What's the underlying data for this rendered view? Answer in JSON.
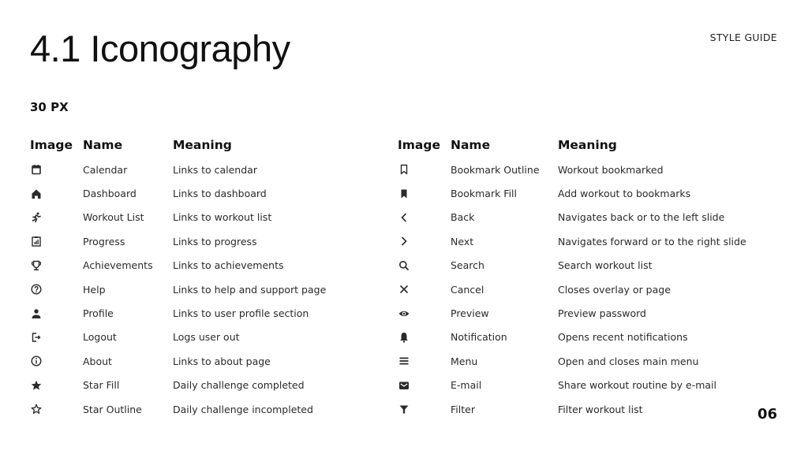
{
  "header": {
    "title": "4.1 Iconography",
    "section_label": "STYLE GUIDE",
    "size_label": "30 PX",
    "page_number": "06"
  },
  "colors": {
    "icon": "#2b2b2b",
    "text": "#1f1f1f",
    "background": "#ffffff"
  },
  "columns": {
    "image": "Image",
    "name": "Name",
    "meaning": "Meaning"
  },
  "left_table": [
    {
      "icon": "calendar-icon",
      "name": "Calendar",
      "meaning": "Links to calendar"
    },
    {
      "icon": "home-icon",
      "name": "Dashboard",
      "meaning": "Links to dashboard"
    },
    {
      "icon": "running-icon",
      "name": "Workout List",
      "meaning": "Links to workout list"
    },
    {
      "icon": "clipboard-chart-icon",
      "name": "Progress",
      "meaning": "Links to progress"
    },
    {
      "icon": "trophy-icon",
      "name": "Achievements",
      "meaning": "Links to achievements"
    },
    {
      "icon": "help-circle-icon",
      "name": "Help",
      "meaning": "Links to help and support page"
    },
    {
      "icon": "person-icon",
      "name": "Profile",
      "meaning": "Links to user profile section"
    },
    {
      "icon": "logout-icon",
      "name": "Logout",
      "meaning": "Logs user out"
    },
    {
      "icon": "info-circle-icon",
      "name": "About",
      "meaning": "Links to about page"
    },
    {
      "icon": "star-fill-icon",
      "name": "Star Fill",
      "meaning": "Daily challenge completed"
    },
    {
      "icon": "star-outline-icon",
      "name": "Star Outline",
      "meaning": "Daily challenge incompleted"
    }
  ],
  "right_table": [
    {
      "icon": "bookmark-outline-icon",
      "name": "Bookmark Outline",
      "meaning": "Workout bookmarked"
    },
    {
      "icon": "bookmark-fill-icon",
      "name": "Bookmark Fill",
      "meaning": "Add workout to bookmarks"
    },
    {
      "icon": "chevron-left-icon",
      "name": "Back",
      "meaning": "Navigates back or to the left slide"
    },
    {
      "icon": "chevron-right-icon",
      "name": "Next",
      "meaning": "Navigates forward or to the right slide"
    },
    {
      "icon": "search-icon",
      "name": "Search",
      "meaning": "Search workout list"
    },
    {
      "icon": "close-icon",
      "name": "Cancel",
      "meaning": "Closes overlay or page"
    },
    {
      "icon": "eye-icon",
      "name": "Preview",
      "meaning": "Preview password"
    },
    {
      "icon": "bell-icon",
      "name": "Notification",
      "meaning": "Opens recent notifications"
    },
    {
      "icon": "menu-icon",
      "name": "Menu",
      "meaning": "Open and closes main menu"
    },
    {
      "icon": "mail-icon",
      "name": "E-mail",
      "meaning": "Share workout routine by e-mail"
    },
    {
      "icon": "filter-icon",
      "name": "Filter",
      "meaning": "Filter workout list"
    }
  ]
}
